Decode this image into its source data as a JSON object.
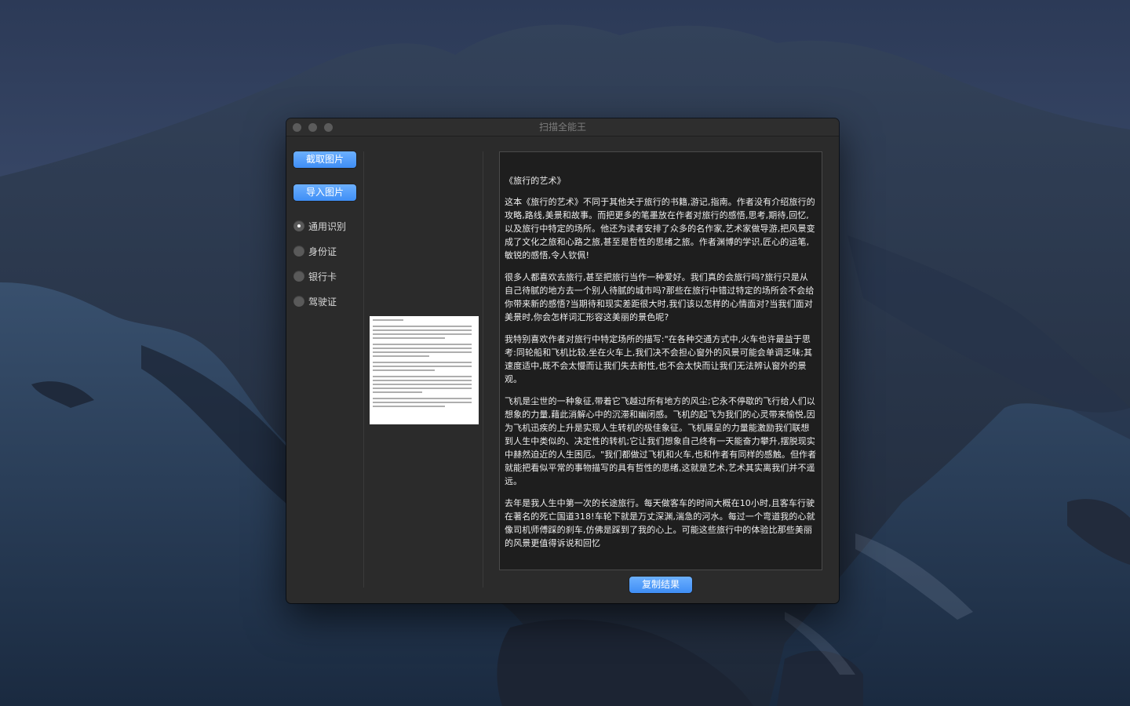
{
  "window": {
    "title": "扫描全能王"
  },
  "sidebar": {
    "capture_label": "截取图片",
    "import_label": "导入图片",
    "modes": [
      {
        "label": "通用识别",
        "selected": true
      },
      {
        "label": "身份证",
        "selected": false
      },
      {
        "label": "银行卡",
        "selected": false
      },
      {
        "label": "驾驶证",
        "selected": false
      }
    ]
  },
  "result": {
    "paragraphs": [
      "《旅行的艺术》",
      "这本《旅行的艺术》不同于其他关于旅行的书籍,游记,指南。作者没有介绍旅行的攻略,路线,美景和故事。而把更多的笔墨放在作者对旅行的感悟,思考,期待,回忆,以及旅行中特定的场所。他还为读者安排了众多的名作家,艺术家做导游,把风景变成了文化之旅和心路之旅,甚至是哲性的思绪之旅。作者渊博的学识,匠心的运笔,敏锐的感悟,令人钦佩!",
      "很多人都喜欢去旅行,甚至把旅行当作一种爱好。我们真的会旅行吗?旅行只是从自己待腻的地方去一个别人待腻的城市吗?那些在旅行中错过特定的场所会不会给你带来新的感悟?当期待和现实差距很大时,我们该以怎样的心情面对?当我们面对美景时,你会怎样词汇形容这美丽的景色呢?",
      "我特别喜欢作者对旅行中特定场所的描写:\"在各种交通方式中,火车也许最益于思考:同轮船和飞机比较,坐在火车上,我们决不会担心窗外的风景可能会单调乏味;其速度适中,既不会太慢而让我们失去耐性,也不会太快而让我们无法辨认窗外的景观。",
      "飞机是尘世的一种象征,带着它飞越过所有地方的风尘;它永不停歇的飞行给人们以想象的力量,藉此消解心中的沉滞和幽闭感。飞机的起飞为我们的心灵带来愉悦,因为飞机迅疾的上升是实现人生转机的极佳象征。飞机展呈的力量能激励我们联想到人生中类似的、决定性的转机;它让我们想象自己终有一天能奋力攀升,摆脱现实中赫然迫近的人生困厄。\"我们都做过飞机和火车,也和作者有同样的感触。但作者就能把看似平常的事物描写的具有哲性的思绪,这就是艺术,艺术其实离我们并不遥远。",
      "去年是我人生中第一次的长途旅行。每天做客车的时间大概在10小时,且客车行驶在著名的死亡国道318!车轮下就是万丈深渊,湍急的河水。每过一个弯道我的心就像司机师傅踩的刹车,仿佛是踩到了我的心上。可能这些旅行中的体验比那些美丽的风景更值得诉说和回忆"
    ]
  },
  "footer": {
    "copy_label": "复制结果"
  }
}
